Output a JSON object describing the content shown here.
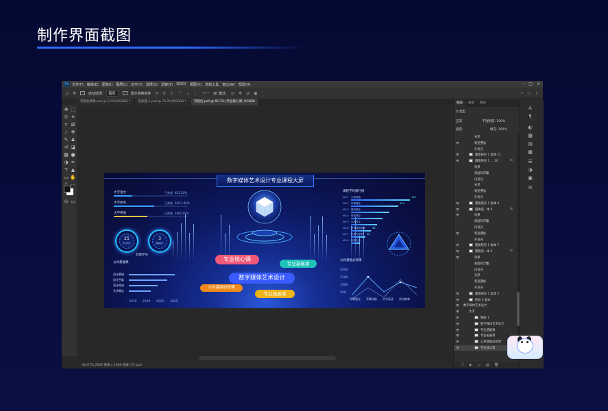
{
  "slide": {
    "title": "制作界面截图"
  },
  "ps": {
    "menu": [
      "文件(F)",
      "编辑(E)",
      "图像(I)",
      "图层(L)",
      "文字(Y)",
      "选择(S)",
      "滤镜(T)",
      "3D(D)",
      "视图(V)",
      "增效工具",
      "窗口(W)",
      "帮助(H)"
    ],
    "options": {
      "auto_select": "自动选择:",
      "auto_select_value": "图层",
      "show_transform": "显示变换控件",
      "mode_3d": "3D 模式:"
    },
    "tabs": [
      "可视化原稿.psd @ 115%(RGB/8) *",
      "未标题-1.psd @ 76.2%(RGB/8) *",
      "可视化.psd @ 66.7% (专业核心课, RGB/8)"
    ],
    "status": "66.67%    2560 像素 x 1080 像素 (72 ppi)",
    "panel_tabs": [
      "图层",
      "通道",
      "路径"
    ],
    "filter_label": "Q 类型",
    "blend_mode": "正常",
    "opacity": "不透明度: 100%",
    "lock": "锁定:",
    "fill": "填充: 100%",
    "layers": [
      {
        "name": "光泽",
        "indent": 2,
        "eye": false,
        "thumb": false,
        "fx": false
      },
      {
        "name": "渐变叠加",
        "indent": 2,
        "eye": true,
        "thumb": false,
        "fx": false
      },
      {
        "name": "外发光",
        "indent": 2,
        "eye": false,
        "thumb": false,
        "fx": false
      },
      {
        "name": "圆角矩形 1 副本 11",
        "indent": 1,
        "eye": true,
        "thumb": true,
        "fx": false
      },
      {
        "name": "圆角矩形 1 ... 10",
        "indent": 1,
        "eye": true,
        "thumb": true,
        "fx": true
      },
      {
        "name": "效果",
        "indent": 2,
        "eye": false,
        "thumb": false,
        "fx": false
      },
      {
        "name": "斜面和浮雕",
        "indent": 2,
        "eye": false,
        "thumb": false,
        "fx": false
      },
      {
        "name": "内发光",
        "indent": 2,
        "eye": false,
        "thumb": false,
        "fx": false
      },
      {
        "name": "光泽",
        "indent": 2,
        "eye": false,
        "thumb": false,
        "fx": false
      },
      {
        "name": "渐变叠加",
        "indent": 2,
        "eye": false,
        "thumb": false,
        "fx": false
      },
      {
        "name": "外发光",
        "indent": 2,
        "eye": false,
        "thumb": false,
        "fx": false
      },
      {
        "name": "圆角矩形 1 副本 9",
        "indent": 1,
        "eye": true,
        "thumb": true,
        "fx": false
      },
      {
        "name": "圆角矩...本 8",
        "indent": 1,
        "eye": true,
        "thumb": true,
        "fx": true
      },
      {
        "name": "效果",
        "indent": 2,
        "eye": true,
        "thumb": false,
        "fx": false
      },
      {
        "name": "斜面和浮雕",
        "indent": 2,
        "eye": false,
        "thumb": false,
        "fx": false
      },
      {
        "name": "内发光",
        "indent": 2,
        "eye": false,
        "thumb": false,
        "fx": false
      },
      {
        "name": "渐变叠加",
        "indent": 2,
        "eye": true,
        "thumb": false,
        "fx": false
      },
      {
        "name": "外发光",
        "indent": 2,
        "eye": false,
        "thumb": false,
        "fx": false
      },
      {
        "name": "圆角矩形 1 副本 7",
        "indent": 1,
        "eye": true,
        "thumb": true,
        "fx": false
      },
      {
        "name": "圆角矩...本 6",
        "indent": 1,
        "eye": true,
        "thumb": true,
        "fx": true
      },
      {
        "name": "效果",
        "indent": 2,
        "eye": true,
        "thumb": false,
        "fx": false
      },
      {
        "name": "斜面和浮雕",
        "indent": 2,
        "eye": false,
        "thumb": false,
        "fx": false
      },
      {
        "name": "内发光",
        "indent": 2,
        "eye": false,
        "thumb": false,
        "fx": false
      },
      {
        "name": "光泽",
        "indent": 2,
        "eye": false,
        "thumb": false,
        "fx": false
      },
      {
        "name": "渐变叠加",
        "indent": 2,
        "eye": false,
        "thumb": false,
        "fx": false
      },
      {
        "name": "外发光",
        "indent": 2,
        "eye": false,
        "thumb": false,
        "fx": false
      },
      {
        "name": "圆角矩形 1 副本 5",
        "indent": 1,
        "eye": true,
        "thumb": true,
        "fx": false
      },
      {
        "name": "形状 4 副本",
        "indent": 1,
        "eye": true,
        "thumb": true,
        "fx": false
      },
      {
        "name": "数字媒体艺术设计",
        "indent": 0,
        "eye": true,
        "thumb": false,
        "fx": false
      },
      {
        "name": "文字",
        "indent": 1,
        "eye": true,
        "thumb": false,
        "fx": false
      },
      {
        "name": "图层 1",
        "indent": 2,
        "eye": true,
        "thumb": true,
        "fx": false
      },
      {
        "name": "数字媒体艺术设计",
        "indent": 2,
        "eye": true,
        "thumb": true,
        "fx": false
      },
      {
        "name": "专业基础课",
        "indent": 2,
        "eye": true,
        "thumb": true,
        "fx": false
      },
      {
        "name": "专业拓展课",
        "indent": 2,
        "eye": true,
        "thumb": true,
        "fx": false
      },
      {
        "name": "公共基础必修课",
        "indent": 2,
        "eye": true,
        "thumb": true,
        "fx": false
      },
      {
        "name": "专业核心课",
        "indent": 2,
        "eye": true,
        "thumb": true,
        "fx": false,
        "selected": true
      }
    ],
    "panel_bottom": "ⓕ ◐ ▭ ▤ 🗑"
  },
  "art": {
    "title": "数字媒体艺术设计专业课程大屏",
    "left_bars": [
      {
        "label": "大学语文",
        "status": "已完成",
        "value": "821.30%",
        "fill": 0.25,
        "color": "#3aa0ff"
      },
      {
        "label": "大学体育",
        "status": "已完成",
        "value": "936.3.60%",
        "fill": 0.55,
        "color": "#3aa0ff"
      },
      {
        "label": "大学英语",
        "status": "已完成",
        "value": "1964.10%",
        "fill": 0.45,
        "color": "#f0c040"
      }
    ],
    "rings": [
      {
        "value": "25",
        "label": "学分统计"
      },
      {
        "value": "3",
        "label": "课程统计"
      }
    ],
    "credits_label": "其他学分",
    "public_label": "公共基础课",
    "public_rows": [
      {
        "label": "设计素描",
        "value": 0.95
      },
      {
        "label": "设计色彩",
        "value": 0.8
      },
      {
        "label": "设计构成",
        "value": 0.6
      },
      {
        "label": "艺术概论",
        "value": 0.45
      }
    ],
    "years": [
      "2019",
      "2020",
      "2021",
      "2022"
    ],
    "rank_title": "课程学时排行榜",
    "ranks": [
      {
        "label": "NO.1",
        "name": "大学英语",
        "value": "100",
        "fill": 0.9
      },
      {
        "label": "NO.2",
        "name": "军事理论",
        "value": "124",
        "fill": 0.72
      },
      {
        "label": "NO.3",
        "name": "操作概论",
        "value": "",
        "fill": 0.58
      },
      {
        "label": "NO.4",
        "name": "体育理论",
        "value": "",
        "fill": 0.48
      },
      {
        "label": "NO.5",
        "name": "大学语文",
        "value": "",
        "fill": 0.4
      },
      {
        "label": "NO.6",
        "name": "思想道德修养",
        "value": "48",
        "fill": 0.3
      },
      {
        "label": "NO.7",
        "name": "形势与政策",
        "value": "36",
        "fill": 0.22
      },
      {
        "label": "NO.8",
        "name": "网络安全",
        "value": "",
        "fill": 0.14
      }
    ],
    "public_required_label": "公共基础必修课",
    "right_axis": [
      "2000",
      "1500",
      "1000",
      "500"
    ],
    "right_x": [
      "军事理论",
      "军事技能",
      "大学英语",
      "劳动教育"
    ],
    "center_pills": [
      {
        "text": "专业核心课",
        "color": "#f05a78"
      },
      {
        "text": "专业基础课",
        "color": "#1fc3b8"
      },
      {
        "text": "数字媒体艺术设计",
        "color": "#3a5cff"
      },
      {
        "text": "公共基础必修课",
        "color": "#f08a1c"
      },
      {
        "text": "专业拓展课",
        "color": "#f0b41c"
      }
    ]
  }
}
